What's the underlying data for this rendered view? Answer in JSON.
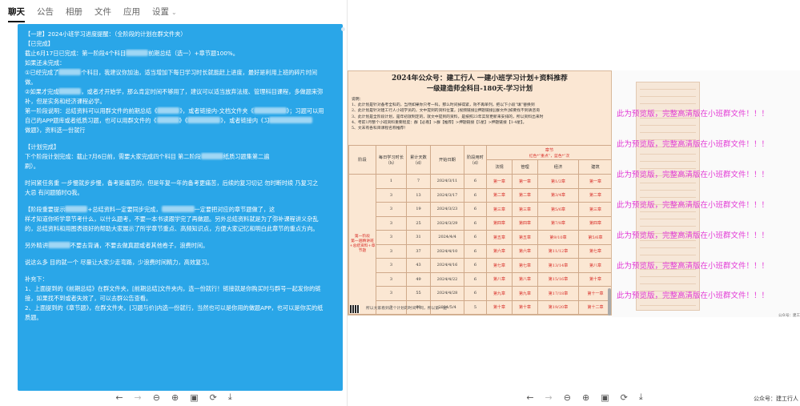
{
  "tabs": [
    {
      "label": "聊天",
      "active": true
    },
    {
      "label": "公告"
    },
    {
      "label": "相册"
    },
    {
      "label": "文件"
    },
    {
      "label": "应用"
    },
    {
      "label": "设置",
      "chevron": true
    }
  ],
  "message": {
    "lines": [
      "【一建】2024小班学习进度提醒：（全阶段的计划在群文件夹）",
      "【已完成】",
      "截止6月17日已完成：第一阶段4个科目[BLUR]前期总结（选一）+章节题100%。",
      "如果还未完成：",
      "①已经完成了[BLUR]个科目，我建议你加油，适当增加下每日学习时长就能赶上进度，最好是利用上班的碎片时间",
      "做。",
      "②如果才完成[BLUR]，或者才开始学，那么肯定时间不够用了，建议可以适当放弃法规、管理科目课程，多做题来弥",
      "补，但是实务和经济课程必学。",
      "第一阶段说明：总结资料可以用群文件的前期总结《[BLUR]》，或者链接内-文档文件夹《[BLUR]》；习题可以用",
      "自己的APP题库或者纸质习题，也可以用群文件的《[BLUR]》《[BLUR]》，或者链接内《习[BLUR]",
      "做题》，资料选一份就行",
      "",
      "【计划完成】",
      "下个阶段计划完成：截止7月6日前，需要大家完成四个科目 第二阶段[BLUR]纸质习题集第二遍",
      "刷）。",
      "",
      "时间紧任务重 一步慢就步步慢，备考是痛苦的，但是年复一年的备考更痛苦，后续的复习切记 勿时断时续 乃复习之",
      "大忌 有问题随时Q我。",
      "",
      "【阶段重要提示[BLUR]+总结资料一定要同步完成，[BLUR]一定要把对应的章节题做了，这",
      "样才知道你听学章节考什么，以什么题考，不要一本书读跟学完了再做题。另外总结资料就是为了弥补课程讲义杂乱",
      "的，总结资料和用图表很好的帮助大家展示了所学章节重点、高频知识点，方便大家记忆和明白此章节的重点方向。",
      "",
      "另外精讲[BLUR]不要去背诵，不要去做真题或者其他卷子，浪费时间。",
      "",
      "说这么多 目的就一个 尽量让大家少走弯路，少浪费时间精力，高效复习。",
      "",
      "补充下：",
      "1、上面提到的《前期总结》在群文件夹，[前期总结]文件夹内，选一份就行！链接就是你购买时与群号一起发你的链",
      "接，如果找不到或者失效了，可以去群公告查看。",
      "2、上面提到的《章节题》，在群文件夹，[习题与价]内选一份就行，当然也可以是你用的做题APP，也可以是你买的纸",
      "质题。"
    ]
  },
  "viewer_toolbar": [
    "←",
    "→",
    "⊖",
    "⊕",
    "▣",
    "⟳",
    "⤓"
  ],
  "document": {
    "title": "2024年公众号：建工行人 一建小班学习计划+资料推荐",
    "subtitle": "一级建造师全科目-180天-学习计划",
    "notes_label": "说明：",
    "notes": [
      "1、此计划是针对备考全科的，当然如果你只考一科，那么时间掉得紧，效不再单列，把以下小段“填”替换到",
      "2、此计划是针对建工行人小班学员的，文中提到的资料位置，[视频链接][押题链接][群文件]如要找不到请咨询",
      "3、此计划是全阶段计划，是年初就制定的，就文中提到的资料，是按照23年实际更新来安排的，所以资料出来时",
      "4、考前1月整个小班资料重要程度：群【必看】>群【推荐】>押题链接【5星】>押题链接【1-4星】。",
      "5、文末有各科目课程名称推荐！"
    ],
    "headers": [
      "阶段",
      "每日学习时长（h）",
      "累计天数（d）",
      "开始日期",
      "阶段用时（d）",
      "章节",
      "法规",
      "管理",
      "经济",
      "建筑"
    ],
    "legend_hint": "红色*“重点”，蓝色*“次",
    "phase_label": "第一阶段",
    "phase_desc": "第一遍精讲班+总结资料+章节题",
    "rows": [
      [
        "1",
        "7",
        "2024/3/11",
        "6",
        "第一章",
        "第一章",
        "第1/2章",
        "第一章"
      ],
      [
        "3",
        "13",
        "2024/3/17",
        "6",
        "第二章",
        "第二章",
        "第3/4章",
        "第二章"
      ],
      [
        "3",
        "19",
        "2024/3/23",
        "6",
        "第三章",
        "第三章",
        "第5/6章",
        "第三章"
      ],
      [
        "3",
        "25",
        "2024/3/29",
        "6",
        "第四章",
        "第四章",
        "第7/8章",
        "第四章"
      ],
      [
        "3",
        "31",
        "2024/4/4",
        "6",
        "第五章",
        "第五章",
        "第9/10章",
        "第5/6章"
      ],
      [
        "3",
        "37",
        "2024/4/10",
        "6",
        "第六章",
        "第六章",
        "第11/12章",
        "第七章"
      ],
      [
        "3",
        "43",
        "2024/4/16",
        "6",
        "第七章",
        "第七章",
        "第13/14章",
        "第八章"
      ],
      [
        "3",
        "49",
        "2024/4/22",
        "6",
        "第八章",
        "第八章",
        "第15/16章",
        "第十章"
      ],
      [
        "3",
        "55",
        "2024/4/28",
        "6",
        "第九章",
        "第九章",
        "第17/18章",
        "第十一章"
      ],
      [
        "3",
        "60",
        "2024/5/4",
        "5",
        "第十章",
        "第十章",
        "第19/20章",
        "第十二章"
      ]
    ],
    "footer": "所以大家看到这个计划的时间不同，所以第一遍"
  },
  "preview_notices": [
    "此为预览版，完整高清版在小班群文件！！！",
    "此为预览版，完整高清版在小班群文件！！！",
    "此为预览版，完整高清版在小班群文件！！！",
    "此为预览版，完整高清版在小班群文件！！！",
    "此为预览版，完整高清版在小班群文件！！！",
    "此为预览版，完整高清版在小班群文件！！！",
    "此为预览版，完整高清版在小班群文件！！！",
    "此为预览版，完整高清版在小班群文件！！！"
  ],
  "sheet_footer": "公众号：建工",
  "watermark": "公众号：建工行人"
}
